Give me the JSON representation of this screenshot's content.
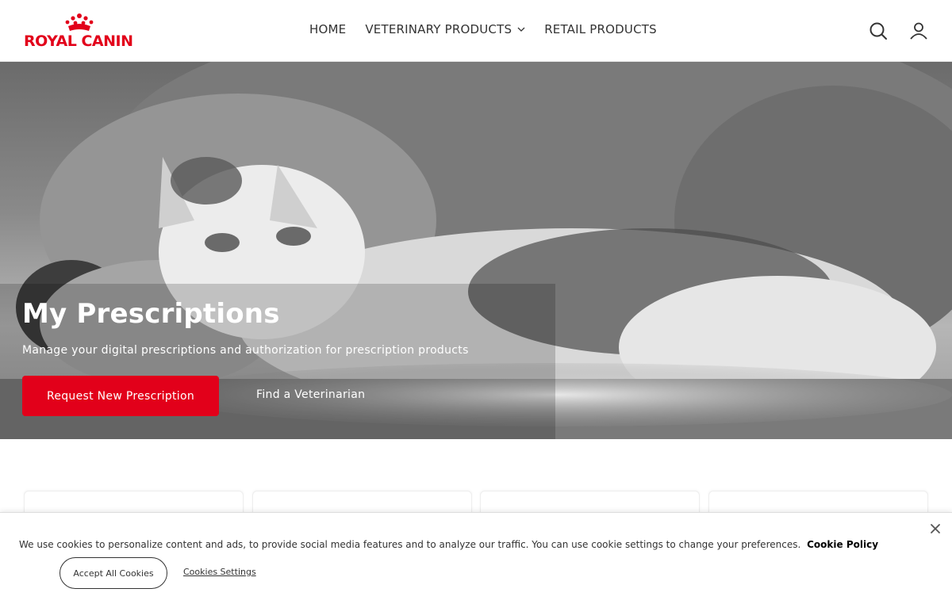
{
  "brand": {
    "logo_text": "ROYAL CANIN",
    "color": "#e2001a"
  },
  "nav": {
    "items": [
      {
        "label": "HOME"
      },
      {
        "label": "VETERINARY PRODUCTS",
        "has_dropdown": true
      },
      {
        "label": "RETAIL PRODUCTS"
      }
    ]
  },
  "header_icons": [
    "search-icon",
    "account-icon"
  ],
  "hero": {
    "title": "My Prescriptions",
    "subtitle": "Manage your digital prescriptions and authorization for prescription products",
    "primary_button": "Request New Prescription",
    "secondary_link": "Find a Veterinarian",
    "image": "grayscale photo of a cat resting on a dog"
  },
  "cards_visible": 4,
  "cookie_banner": {
    "text": "We use cookies to personalize content and ads, to provide social media features and to analyze our traffic. You can use cookie settings to change your preferences.",
    "policy_link": "Cookie Policy",
    "accept_button": "Accept All Cookies",
    "settings_link": "Cookies Settings",
    "close_icon": "close-icon"
  }
}
